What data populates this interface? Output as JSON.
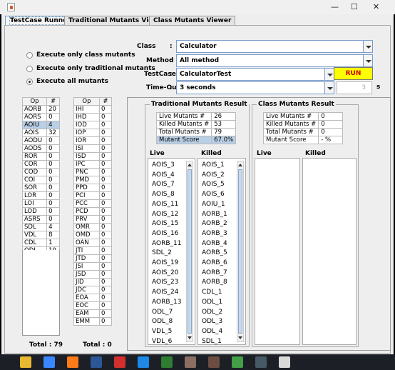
{
  "window": {
    "minimize_glyph": "—",
    "maximize_glyph": "☐",
    "close_glyph": "✕",
    "icon": "java-icon"
  },
  "tabs": [
    {
      "label": "TestCase Runner",
      "active": true
    },
    {
      "label": "Traditional Mutants Viewer",
      "active": false
    },
    {
      "label": "Class Mutants Viewer",
      "active": false
    }
  ],
  "options": [
    {
      "label": "Execute only class mutants",
      "selected": false
    },
    {
      "label": "Execute only traditional mutants",
      "selected": false
    },
    {
      "label": "Execute all mutants",
      "selected": true
    }
  ],
  "form": {
    "class_label": "Class",
    "class_value": "Calculator",
    "method_label": "Method",
    "method_value": "All method",
    "testcase_label": "TestCase",
    "testcase_value": "CalculatorTest",
    "timeout_label": "Time-Out",
    "timeout_value": "3 seconds",
    "run_label": "RUN",
    "spinner_value": "3",
    "unit": "s",
    "colon": ":"
  },
  "trad_ops": {
    "header": [
      "Op",
      "#"
    ],
    "rows": [
      [
        "AORB",
        "20"
      ],
      [
        "AORS",
        "0"
      ],
      [
        "AOIU",
        "4"
      ],
      [
        "AOIS",
        "32"
      ],
      [
        "AODU",
        "0"
      ],
      [
        "AODS",
        "0"
      ],
      [
        "ROR",
        "0"
      ],
      [
        "COR",
        "0"
      ],
      [
        "COD",
        "0"
      ],
      [
        "COI",
        "0"
      ],
      [
        "SOR",
        "0"
      ],
      [
        "LOR",
        "0"
      ],
      [
        "LOI",
        "0"
      ],
      [
        "LOD",
        "0"
      ],
      [
        "ASRS",
        "0"
      ],
      [
        "SDL",
        "4"
      ],
      [
        "VDL",
        "8"
      ],
      [
        "CDL",
        "1"
      ],
      [
        "ODL",
        "10"
      ]
    ],
    "selected_row": 2,
    "total": "Total : 79"
  },
  "class_ops": {
    "header": [
      "Op",
      "#"
    ],
    "rows": [
      [
        "IHI",
        "0"
      ],
      [
        "IHD",
        "0"
      ],
      [
        "IOD",
        "0"
      ],
      [
        "IOP",
        "0"
      ],
      [
        "IOR",
        "0"
      ],
      [
        "ISI",
        "0"
      ],
      [
        "ISD",
        "0"
      ],
      [
        "IPC",
        "0"
      ],
      [
        "PNC",
        "0"
      ],
      [
        "PMD",
        "0"
      ],
      [
        "PPD",
        "0"
      ],
      [
        "PCI",
        "0"
      ],
      [
        "PCC",
        "0"
      ],
      [
        "PCD",
        "0"
      ],
      [
        "PRV",
        "0"
      ],
      [
        "OMR",
        "0"
      ],
      [
        "OMD",
        "0"
      ],
      [
        "OAN",
        "0"
      ],
      [
        "JTI",
        "0"
      ],
      [
        "JTD",
        "0"
      ],
      [
        "JSI",
        "0"
      ],
      [
        "JSD",
        "0"
      ],
      [
        "JID",
        "0"
      ],
      [
        "JDC",
        "0"
      ],
      [
        "EOA",
        "0"
      ],
      [
        "EOC",
        "0"
      ],
      [
        "EAM",
        "0"
      ],
      [
        "EMM",
        "0"
      ]
    ],
    "total": "Total : 0"
  },
  "traditional_result": {
    "title": "Traditional Mutants Result",
    "stats": [
      {
        "label": "Live Mutants #",
        "value": "26"
      },
      {
        "label": "Killed Mutants #",
        "value": "53"
      },
      {
        "label": "Total Mutants #",
        "value": "79"
      },
      {
        "label": "Mutant Score",
        "value": "67.0%"
      }
    ],
    "live_title": "Live",
    "killed_title": "Killed",
    "live": [
      "AOIS_3",
      "AOIS_4",
      "AOIS_7",
      "AOIS_8",
      "AOIS_11",
      "AOIS_12",
      "AOIS_15",
      "AOIS_16",
      "AORB_11",
      "SDL_2",
      "AOIS_19",
      "AOIS_20",
      "AOIS_23",
      "AOIS_24",
      "AORB_13",
      "ODL_7",
      "ODL_8",
      "VDL_5",
      "VDL_6"
    ],
    "killed": [
      "AOIS_1",
      "AOIS_2",
      "AOIS_5",
      "AOIS_6",
      "AOIU_1",
      "AORB_1",
      "AORB_2",
      "AORB_3",
      "AORB_4",
      "AORB_5",
      "AORB_6",
      "AORB_7",
      "AORB_8",
      "CDL_1",
      "ODL_1",
      "ODL_2",
      "ODL_3",
      "ODL_4",
      "SDL_1"
    ]
  },
  "class_result": {
    "title": "Class Mutants Result",
    "stats": [
      {
        "label": "Live Mutants #",
        "value": "0"
      },
      {
        "label": "Killed Mutants #",
        "value": "0"
      },
      {
        "label": "Total Mutants #",
        "value": "0"
      },
      {
        "label": "Mutant Score",
        "value": "- %"
      }
    ],
    "live_title": "Live",
    "killed_title": "Killed"
  },
  "taskbar_icons": [
    "file-explorer-icon",
    "chrome-icon",
    "firefox-icon",
    "word-icon",
    "acrobat-icon",
    "outlook-icon",
    "photos-icon",
    "notepad-icon",
    "game-icon",
    "wechat-icon",
    "terminal-icon",
    "java-icon"
  ],
  "colors": {
    "accent": "#b8cfe5",
    "run_bg": "#ffff00",
    "run_text": "#cc0000"
  }
}
